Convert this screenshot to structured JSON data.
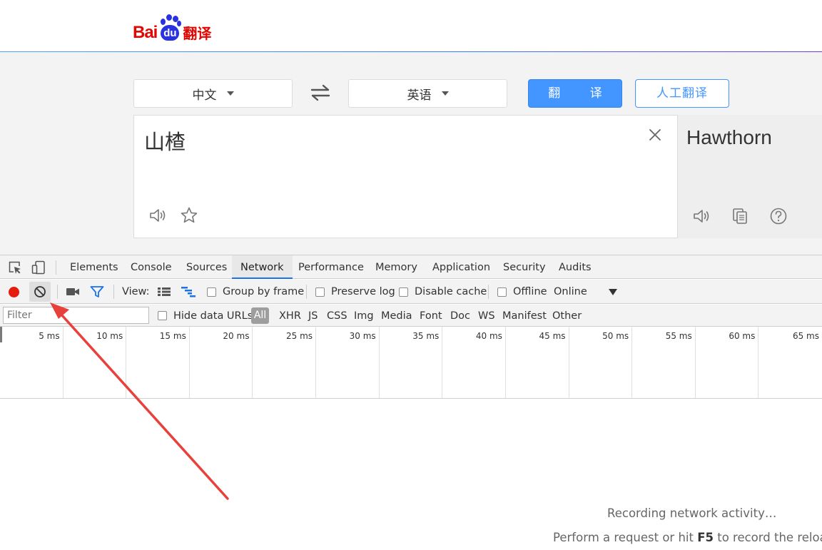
{
  "baidu": {
    "logo": {
      "text_left": "Bai",
      "text_paw": "du",
      "text_right": "翻译"
    },
    "source_lang": "中文",
    "target_lang": "英语",
    "translate_button": "翻 译",
    "human_translate_button": "人工翻译",
    "source_text": "山楂",
    "result_text": "Hawthorn",
    "colors": {
      "brand_blue": "#4395ff",
      "logo_red": "#e10601",
      "logo_blue": "#2932e1"
    }
  },
  "devtools": {
    "tabs": [
      "Elements",
      "Console",
      "Sources",
      "Network",
      "Performance",
      "Memory",
      "Application",
      "Security",
      "Audits"
    ],
    "active_tab": "Network",
    "toolbar": {
      "view_label": "View:",
      "group_by_frame": "Group by frame",
      "preserve_log": "Preserve log",
      "disable_cache": "Disable cache",
      "offline": "Offline",
      "throttling": "Online"
    },
    "filter": {
      "placeholder": "Filter",
      "hide_data_urls": "Hide data URLs",
      "types": [
        "All",
        "XHR",
        "JS",
        "CSS",
        "Img",
        "Media",
        "Font",
        "Doc",
        "WS",
        "Manifest",
        "Other"
      ]
    },
    "timeline_labels": [
      "5 ms",
      "10 ms",
      "15 ms",
      "20 ms",
      "25 ms",
      "30 ms",
      "35 ms",
      "40 ms",
      "45 ms",
      "50 ms",
      "55 ms",
      "60 ms",
      "65 ms"
    ],
    "recording_message": "Recording network activity…",
    "hint": {
      "before": "Perform a request or hit ",
      "key": "F5",
      "after": " to record the reload."
    },
    "colors": {
      "record_red": "#e51c0b",
      "active_tab_underline": "#1a73e8",
      "annotation_arrow": "#e8413c"
    }
  }
}
